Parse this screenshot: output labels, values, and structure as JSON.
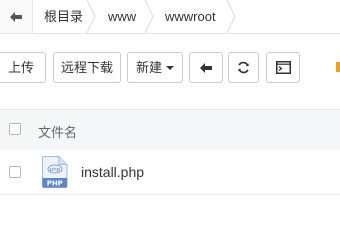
{
  "breadcrumb": {
    "items": [
      "根目录",
      "www",
      "wwwroot"
    ]
  },
  "toolbar": {
    "upload_label": "上传",
    "remote_download_label": "远程下载",
    "new_label": "新建"
  },
  "table": {
    "header": {
      "name": "文件名"
    },
    "rows": [
      {
        "name": "install.php",
        "icon_text": "PHP",
        "icon_sub": "php"
      }
    ]
  },
  "colors": {
    "php_icon_blue": "#5b87c8",
    "border": "#cccccc",
    "header_bg": "#f5f6f8"
  }
}
